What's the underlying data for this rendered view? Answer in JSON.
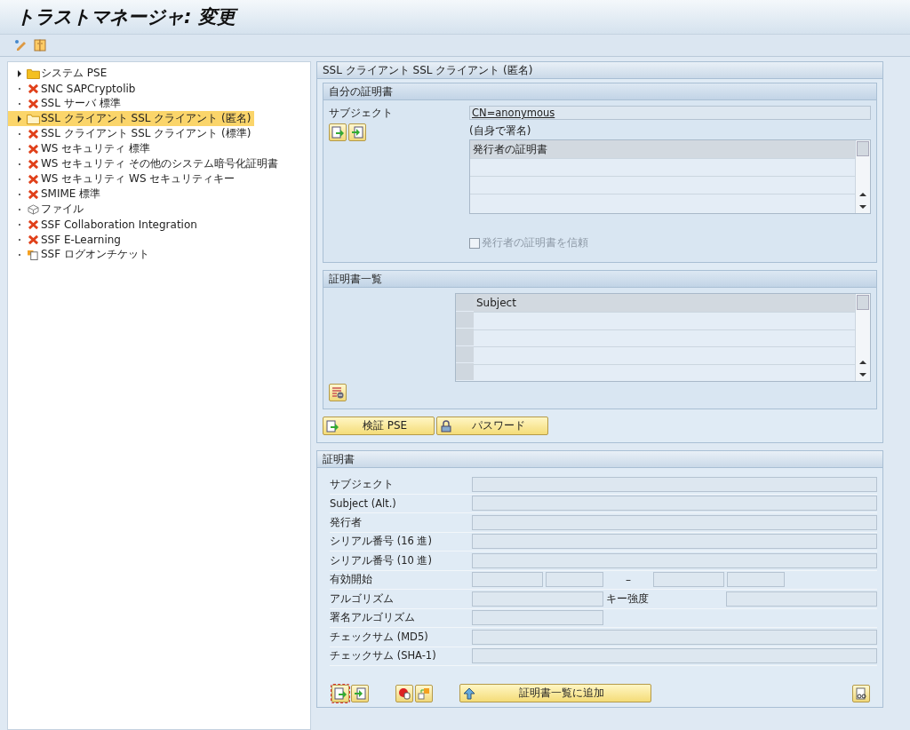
{
  "window": {
    "title": "トラストマネージャ: 変更"
  },
  "tree": {
    "items": [
      {
        "label": "システム PSE",
        "kind": "folder",
        "expandable": true,
        "selected": false
      },
      {
        "label": "SNC SAPCryptolib",
        "kind": "error",
        "expandable": false,
        "selected": false
      },
      {
        "label": "SSL サーバ 標準",
        "kind": "error",
        "expandable": false,
        "selected": false
      },
      {
        "label": "SSL クライアント SSL クライアント (匿名)",
        "kind": "folder",
        "expandable": true,
        "selected": true
      },
      {
        "label": "SSL クライアント SSL クライアント (標準)",
        "kind": "error",
        "expandable": false,
        "selected": false
      },
      {
        "label": "WS セキュリティ 標準",
        "kind": "error",
        "expandable": false,
        "selected": false
      },
      {
        "label": "WS セキュリティ その他のシステム暗号化証明書",
        "kind": "error",
        "expandable": false,
        "selected": false
      },
      {
        "label": "WS セキュリティ WS セキュリティキー",
        "kind": "error",
        "expandable": false,
        "selected": false
      },
      {
        "label": "SMIME 標準",
        "kind": "error",
        "expandable": false,
        "selected": false
      },
      {
        "label": "ファイル",
        "kind": "box",
        "expandable": false,
        "selected": false
      },
      {
        "label": "SSF Collaboration Integration",
        "kind": "error",
        "expandable": false,
        "selected": false
      },
      {
        "label": "SSF E-Learning",
        "kind": "error",
        "expandable": false,
        "selected": false
      },
      {
        "label": "SSF ログオンチケット",
        "kind": "ticket",
        "expandable": false,
        "selected": false
      }
    ]
  },
  "panel": {
    "title": "SSL クライアント SSL クライアント (匿名)",
    "own_certificate": {
      "title": "自分の証明書",
      "subject_label": "サブジェクト",
      "subject_value": "CN=anonymous",
      "signed_note": "(自身で署名)",
      "issuer_table": {
        "column": "発行者の証明書"
      },
      "trust_checkbox": {
        "label": "発行者の証明書を信頼",
        "checked": false,
        "disabled": true
      }
    },
    "certificate_list": {
      "title": "証明書一覧",
      "column": "Subject"
    },
    "buttons": [
      {
        "label": "検証 PSE",
        "kind": "import"
      },
      {
        "label": "パスワード",
        "kind": "lock"
      }
    ]
  },
  "certificate": {
    "title": "証明書",
    "fields": [
      {
        "kind": "full",
        "label": "サブジェクト"
      },
      {
        "kind": "full",
        "label": "Subject (Alt.)"
      },
      {
        "kind": "full",
        "label": "発行者"
      },
      {
        "kind": "full",
        "label": "シリアル番号 (16 進)"
      },
      {
        "kind": "full",
        "label": "シリアル番号 (10 進)"
      },
      {
        "kind": "range",
        "label": "有効開始",
        "separator": "–"
      },
      {
        "kind": "pair",
        "label": "アルゴリズム",
        "label2": "キー強度"
      },
      {
        "kind": "short",
        "label": "署名アルゴリズム"
      },
      {
        "kind": "full",
        "label": "チェックサム (MD5)"
      },
      {
        "kind": "full",
        "label": "チェックサム (SHA-1)"
      }
    ],
    "add_button": "証明書一覧に追加"
  }
}
